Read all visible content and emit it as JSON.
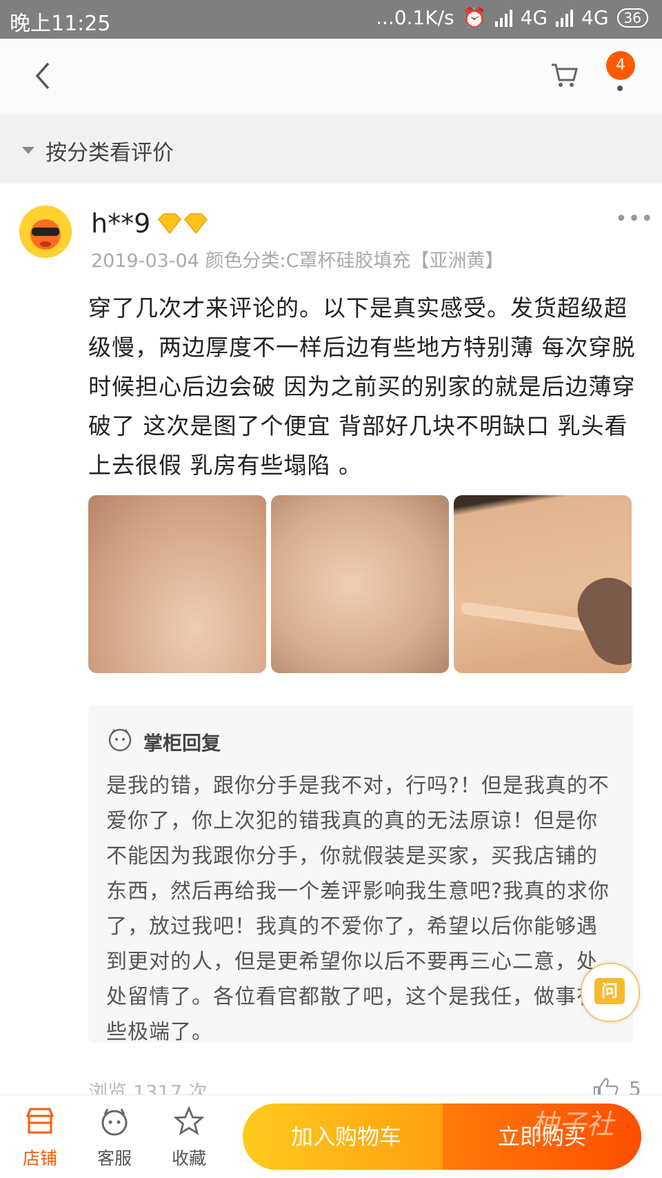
{
  "status_bar": {
    "time": "晚上11:25",
    "speed": "...0.1K/s",
    "network1": "4G",
    "network2": "4G",
    "battery": "36"
  },
  "nav": {
    "notification_count": "4"
  },
  "category": {
    "label": "按分类看评价"
  },
  "review": {
    "username": "h**9",
    "meta": "2019-03-04 颜色分类:C罩杯硅胶填充【亚洲黄】",
    "text": "穿了几次才来评论的。以下是真实感受。发货超级超级慢，两边厚度不一样后边有些地方特别薄 每次穿脱时候担心后边会破 因为之前买的别家的就是后边薄穿破了 这次是图了个便宜 背部好几块不明缺口 乳头看上去很假 乳房有些塌陷 。",
    "photo_count": 3
  },
  "reply": {
    "title": "掌柜回复",
    "text": "是我的错，跟你分手是我不对，行吗?！但是我真的不爱你了，你上次犯的错我真的真的无法原谅！但是你不能因为我跟你分手，你就假装是买家，买我店铺的东西，然后再给我一个差评影响我生意吧?我真的求你了，放过我吧！我真的不爱你了，希望以后你能够遇到更对的人，但是更希望你以后不要再三心二意，处处留情了。各位看官都散了吧，这个是我任，做事有些极端了。"
  },
  "ask_button": {
    "label": "问"
  },
  "footer_stats": {
    "views": "浏览 1317 次",
    "likes": "5"
  },
  "bottom_bar": {
    "shop": "店铺",
    "service": "客服",
    "favorite": "收藏",
    "add_to_cart": "加入购物车",
    "buy_now": "立即购买"
  },
  "watermark": "柚子社",
  "colors": {
    "accent": "#ff5a00",
    "cart_gradient_start": "#ffcb1d",
    "buy_gradient_end": "#ff4e00"
  }
}
